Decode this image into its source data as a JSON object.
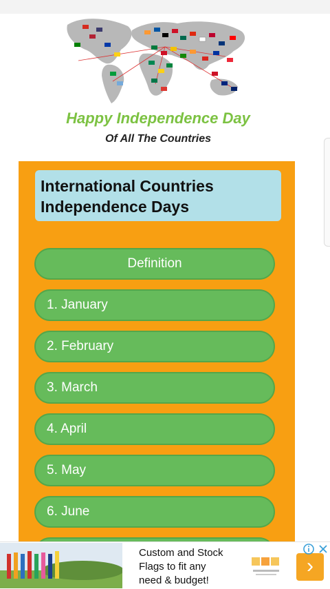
{
  "header": {
    "headline": "Happy Independence Day",
    "subline": "Of All The Countries"
  },
  "panel": {
    "title_line1": "International Countries",
    "title_line2": "Independence Days"
  },
  "menu": [
    {
      "label": "Definition"
    },
    {
      "label": "1. January"
    },
    {
      "label": "2. February"
    },
    {
      "label": "3. March"
    },
    {
      "label": "4. April"
    },
    {
      "label": "5. May"
    },
    {
      "label": "6. June"
    }
  ],
  "ad": {
    "text_line1": "Custom and Stock",
    "text_line2": "Flags to fit any",
    "text_line3": "need & budget!",
    "next_icon": "chevron-right-icon",
    "info_icon": "info-icon",
    "close_icon": "close-icon"
  },
  "colors": {
    "panel_bg": "#f89f12",
    "title_box_bg": "#b2e0e8",
    "button_green": "#66bb5b",
    "headline_green": "#7cc242",
    "ad_next_orange": "#f5a623"
  }
}
